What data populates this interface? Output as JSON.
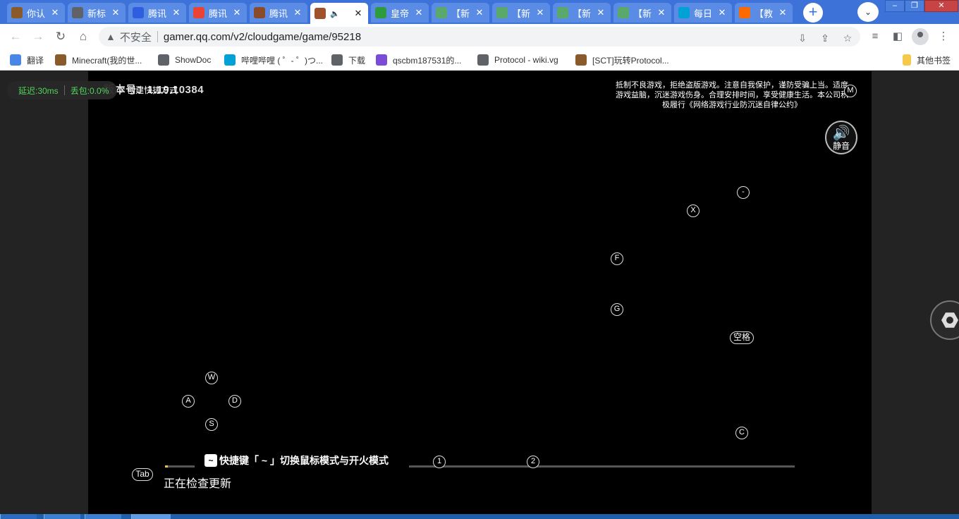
{
  "window": {
    "minimize": "–",
    "restore": "❐",
    "close": "✕"
  },
  "tabs": [
    {
      "title": "你认",
      "icon": "minecraft-block-icon",
      "color": "#8b5a2b",
      "active": false
    },
    {
      "title": "新标",
      "icon": "globe-icon",
      "color": "#5f6368",
      "active": false
    },
    {
      "title": "腾讯",
      "icon": "baidu-paw-icon",
      "color": "#2f5fe0",
      "active": false
    },
    {
      "title": "腾讯",
      "icon": "google-g-icon",
      "color": "#ea4335",
      "active": false
    },
    {
      "title": "腾讯",
      "icon": "game-logo-icon",
      "color": "#8a4b2a",
      "active": false
    },
    {
      "title": "",
      "icon": "game-avatar-icon",
      "color": "#a0522d",
      "active": true,
      "audio": "🔈"
    },
    {
      "title": "皇帝",
      "icon": "grid-app-icon",
      "color": "#2e9b3e",
      "active": false
    },
    {
      "title": "【新",
      "icon": "panda-icon",
      "color": "#5aa86a",
      "active": false
    },
    {
      "title": "【新",
      "icon": "panda-icon",
      "color": "#5aa86a",
      "active": false
    },
    {
      "title": "【新",
      "icon": "panda-icon",
      "color": "#5aa86a",
      "active": false
    },
    {
      "title": "【新",
      "icon": "panda-icon",
      "color": "#5aa86a",
      "active": false
    },
    {
      "title": "每日",
      "icon": "bilibili-tv-icon",
      "color": "#00a1d6",
      "active": false
    },
    {
      "title": "【教",
      "icon": "flag-icon",
      "color": "#ff6a00",
      "active": false
    }
  ],
  "toolbar": {
    "back": "←",
    "forward": "→",
    "reload": "↻",
    "home": "⌂",
    "security_label": "不安全",
    "warn_glyph": "▲",
    "url": "gamer.qq.com/v2/cloudgame/game/95218",
    "install": "⇩",
    "share": "⇪",
    "star": "☆",
    "media": "≡",
    "sidepanel": "◧",
    "menu": "⋮",
    "new_tab": "+",
    "tab_search": "⌄"
  },
  "bookmarks": [
    {
      "label": "翻译",
      "icon": "google-translate-icon",
      "color": "#4a86e8"
    },
    {
      "label": "Minecraft(我的世...",
      "icon": "minecraft-block-icon",
      "color": "#8b5a2b"
    },
    {
      "label": "ShowDoc",
      "icon": "globe-icon",
      "color": "#5f6368"
    },
    {
      "label": "哔哩哔哩 ( ゜- ゜)つ...",
      "icon": "bilibili-tv-icon",
      "color": "#00a1d6"
    },
    {
      "label": "下载",
      "icon": "globe-icon",
      "color": "#5f6368"
    },
    {
      "label": "qscbm187531的...",
      "icon": "cloud-icon",
      "color": "#7b4cd8"
    },
    {
      "label": "Protocol - wiki.vg",
      "icon": "globe-icon",
      "color": "#5f6368"
    },
    {
      "label": "[SCT]玩转Protocol...",
      "icon": "minecraft-block-icon",
      "color": "#8b5a2b"
    }
  ],
  "other_bookmarks": "其他书签",
  "game": {
    "latency": "延迟:30ms",
    "packet_loss": "丢包:0.0%",
    "shortcut_link": "创建快捷方式",
    "version": "版本号：1.19.10384",
    "notice": "抵制不良游戏，拒绝盗版游戏。注意自我保护，谨防受骗上当。适度游戏益脑，沉迷游戏伤身。合理安排时间，享受健康生活。本公司积极履行《网络游戏行业防沉迷自律公约》",
    "mute_label": "静音",
    "mute_icon": "🔊",
    "keys": {
      "m": "M",
      "minus": "-",
      "x": "X",
      "f": "F",
      "g": "G",
      "space": "空格",
      "w": "W",
      "a": "A",
      "d": "D",
      "s": "S",
      "c": "C",
      "tab": "Tab",
      "one": "1",
      "two": "2"
    },
    "progress": 0.005,
    "status": "正在检查更新",
    "toast_key": "~",
    "toast_text": "快捷键「 ~ 」切换鼠标模式与开火模式"
  }
}
